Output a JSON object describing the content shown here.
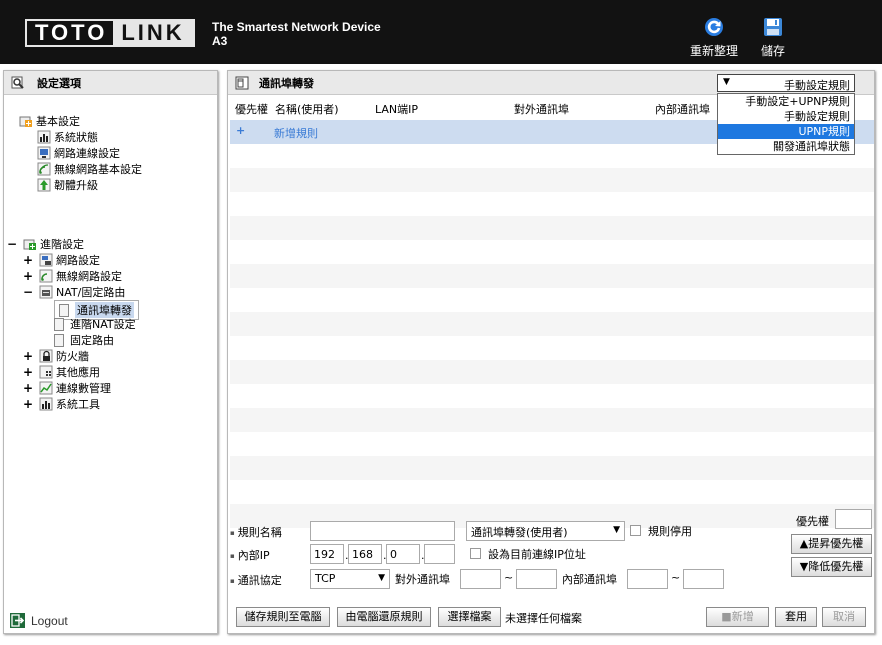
{
  "header": {
    "logo_left": "TOTO",
    "logo_right": "LINK",
    "tagline": "The Smartest Network Device",
    "model": "A3",
    "refresh_label": "重新整理",
    "save_label": "儲存"
  },
  "sidebar": {
    "title": "設定選項",
    "basic": {
      "label": "基本設定",
      "items": [
        "系統狀態",
        "網路連線設定",
        "無線網路基本設定",
        "韌體升級"
      ]
    },
    "advanced": {
      "label": "進階設定",
      "network": "網路設定",
      "wireless": "無線網路設定",
      "nat": "NAT/固定路由",
      "nat_items": [
        "通訊埠轉發",
        "進階NAT設定",
        "固定路由"
      ],
      "firewall": "防火牆",
      "other": "其他應用",
      "usb": "連線數管理",
      "tools": "系統工具"
    },
    "logout": "Logout"
  },
  "main": {
    "title": "通訊埠轉發",
    "mode": {
      "selected": "手動設定規則",
      "options": [
        "手動設定+UPNP規則",
        "手動設定規則",
        "UPNP規則",
        "關發通訊埠狀態"
      ],
      "highlighted_index": 2
    },
    "columns": [
      "優先權",
      "名稱(使用者)",
      "LAN端IP",
      "對外通訊埠",
      "內部通訊埠"
    ],
    "add_rule": "新增規則",
    "form": {
      "rule_name_label": "規則名稱",
      "rule_name_value": "",
      "service_select": "通訊埠轉發(使用者)",
      "rule_disable_label": "規則停用",
      "priority_label": "優先權",
      "priority_value": "",
      "raise_priority": "▲提昇優先權",
      "lower_priority": "▼降低優先權",
      "internal_ip_label": "內部IP",
      "ip": [
        "192",
        "168",
        "0",
        ""
      ],
      "set_current_ip_label": "設為目前連線IP位址",
      "protocol_label": "通訊協定",
      "protocol_value": "TCP",
      "external_port_label": "對外通訊埠",
      "internal_port_label": "內部通訊埠",
      "port_sep": "~"
    },
    "bottom": {
      "save_to_pc": "儲存規則至電腦",
      "restore_from_pc": "由電腦還原規則",
      "choose_file": "選擇檔案",
      "no_file": "未選擇任何檔案",
      "add": "■新增",
      "apply": "套用",
      "cancel": "取消"
    }
  }
}
